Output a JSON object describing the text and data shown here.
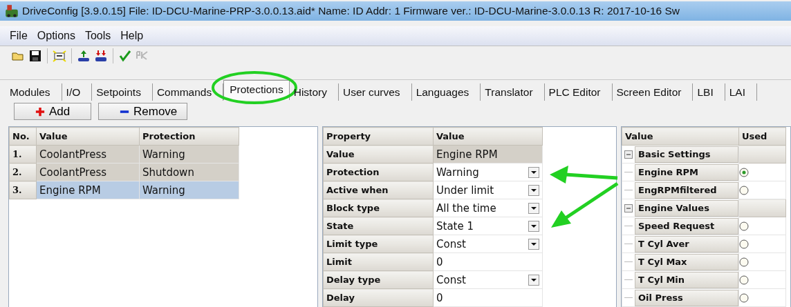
{
  "window": {
    "title": "DriveConfig [3.9.0.15]  File: ID-DCU-Marine-PRP-3.0.0.13.aid*  Name: ID  Addr: 1  Firmware ver.: ID-DCU-Marine-3.0.0.13 R: 2017-10-16  Sw"
  },
  "menu": [
    "File",
    "Options",
    "Tools",
    "Help"
  ],
  "tabs": [
    {
      "label": "Modules",
      "selected": false
    },
    {
      "label": "I/O",
      "selected": false
    },
    {
      "label": "Setpoints",
      "selected": false
    },
    {
      "label": "Commands",
      "selected": false
    },
    {
      "label": "Protections",
      "selected": true
    },
    {
      "label": "History",
      "selected": false
    },
    {
      "label": "User curves",
      "selected": false
    },
    {
      "label": "Languages",
      "selected": false
    },
    {
      "label": "Translator",
      "selected": false
    },
    {
      "label": "PLC Editor",
      "selected": false
    },
    {
      "label": "Screen Editor",
      "selected": false
    },
    {
      "label": "LBI",
      "selected": false
    },
    {
      "label": "LAI",
      "selected": false
    }
  ],
  "actions": [
    {
      "label": "Add",
      "kind": "add"
    },
    {
      "label": "Remove",
      "kind": "remove"
    }
  ],
  "protections_table": {
    "columns": [
      "No.",
      "Value",
      "Protection"
    ],
    "rows": [
      {
        "no": "1.",
        "value": "CoolantPress",
        "protection": "Warning",
        "selected": false
      },
      {
        "no": "2.",
        "value": "CoolantPress",
        "protection": "Shutdown",
        "selected": false
      },
      {
        "no": "3.",
        "value": "Engine RPM",
        "protection": "Warning",
        "selected": true
      }
    ]
  },
  "property_table": {
    "columns": [
      "Property",
      "Value"
    ],
    "rows": [
      {
        "property": "Value",
        "value": "Engine RPM",
        "kind": "readonly"
      },
      {
        "property": "Protection",
        "value": "Warning",
        "kind": "dropdown"
      },
      {
        "property": "Active when",
        "value": "Under limit",
        "kind": "dropdown"
      },
      {
        "property": "Block type",
        "value": "All the time",
        "kind": "dropdown"
      },
      {
        "property": "State",
        "value": "State 1",
        "kind": "dropdown"
      },
      {
        "property": "Limit type",
        "value": "Const",
        "kind": "dropdown"
      },
      {
        "property": "Limit",
        "value": "0",
        "kind": "text"
      },
      {
        "property": "Delay type",
        "value": "Const",
        "kind": "dropdown"
      },
      {
        "property": "Delay",
        "value": "0",
        "kind": "text"
      }
    ]
  },
  "value_tree": {
    "columns": [
      "Value",
      "Used"
    ],
    "groups": [
      {
        "label": "Basic Settings",
        "expanded": true,
        "children": [
          {
            "label": "Engine RPM",
            "selected": true
          },
          {
            "label": "EngRPMfiltered",
            "selected": false
          }
        ]
      },
      {
        "label": "Engine Values",
        "expanded": true,
        "children": [
          {
            "label": "Speed Request",
            "selected": false
          },
          {
            "label": "T Cyl Aver",
            "selected": false
          },
          {
            "label": "T Cyl Max",
            "selected": false
          },
          {
            "label": "T Cyl Min",
            "selected": false
          },
          {
            "label": "Oil Press",
            "selected": false
          }
        ]
      }
    ]
  }
}
